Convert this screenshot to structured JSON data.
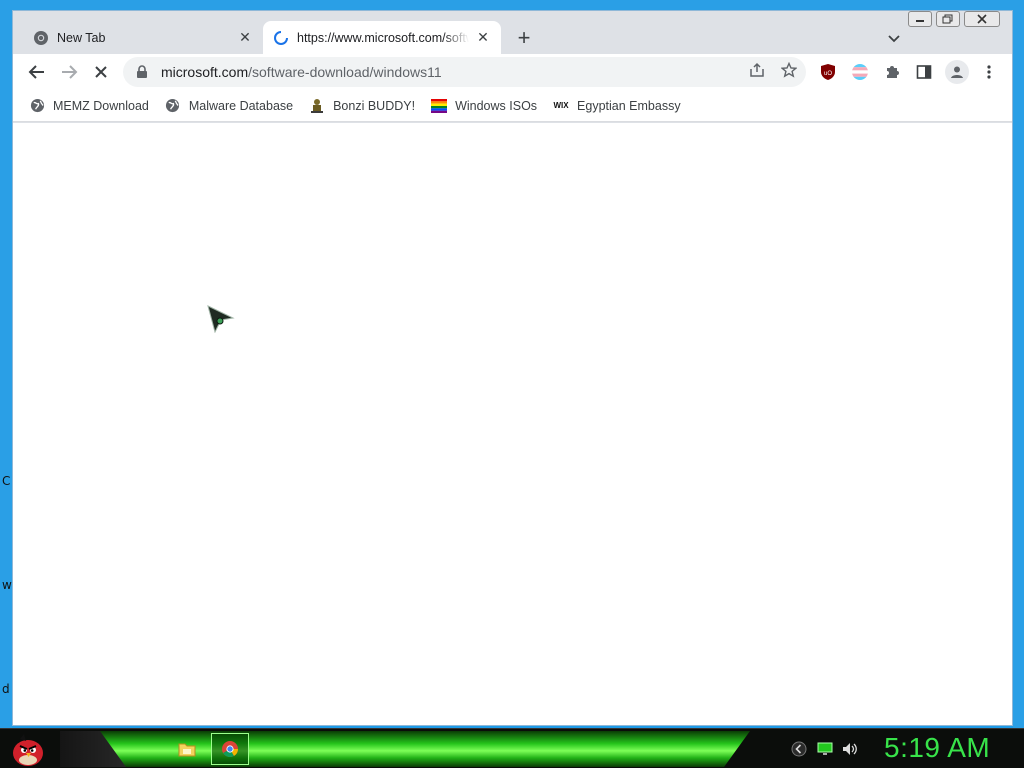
{
  "browser": {
    "tabs": [
      {
        "title": "New Tab",
        "active": false
      },
      {
        "title": "https://www.microsoft.com/software-download/windows11",
        "active": true
      }
    ],
    "new_tab_symbol": "+",
    "url_host": "microsoft.com",
    "url_path": "/software-download/windows11",
    "bookmarks": [
      {
        "label": "MEMZ Download",
        "icon": "globe-icon"
      },
      {
        "label": "Malware Database",
        "icon": "globe-icon"
      },
      {
        "label": "Bonzi BUDDY!",
        "icon": "bonzi-icon"
      },
      {
        "label": "Windows ISOs",
        "icon": "rainbow-flag-icon"
      },
      {
        "label": "Egyptian Embassy",
        "icon": "wix-icon"
      }
    ],
    "wix_label": "WIX",
    "loading": true
  },
  "desktop": {
    "edge_letters": [
      "C",
      "w",
      "d"
    ]
  },
  "taskbar": {
    "clock": "5:19 AM"
  },
  "colors": {
    "desktop": "#1e9be8",
    "tab_strip": "#dee1e6",
    "taskbar_green": "#25c41b",
    "clock": "#38e34a",
    "ublock": "#800000"
  }
}
